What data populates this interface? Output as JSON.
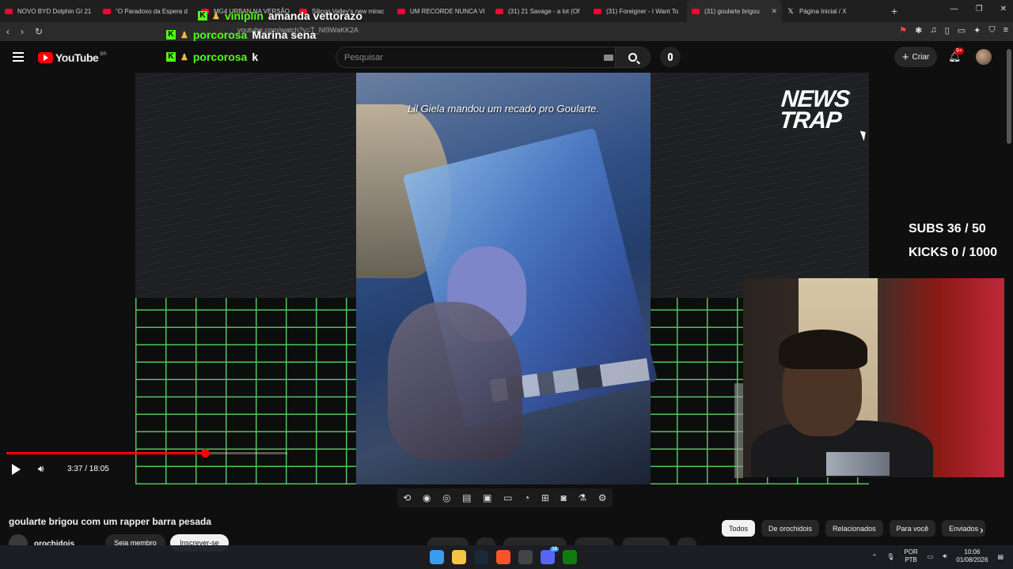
{
  "browser": {
    "tabs": [
      {
        "label": "NOVO BYD Dolphin GI 21",
        "icon": "youtube-icon"
      },
      {
        "label": "\"O Paradoxo da Espera d",
        "icon": "youtube-icon"
      },
      {
        "label": "MG4 URBAN NA VERSÃO",
        "icon": "youtube-icon"
      },
      {
        "label": "Silicon Valley's new mirac",
        "icon": "youtube-icon"
      },
      {
        "label": "UM RECORDE NUNCA VI",
        "icon": "youtube-icon"
      },
      {
        "label": "(31) 21 Savage - a lot (Of",
        "icon": "youtube-icon"
      },
      {
        "label": "(31) Foreigner - I Want To",
        "icon": "youtube-icon"
      },
      {
        "label": "(31) goularte brigou",
        "icon": "youtube-icon",
        "active": true
      },
      {
        "label": "Página Inicial / X",
        "icon": "x-icon"
      }
    ],
    "new_tab": "+",
    "url": "youtube.com/watch?v=T_NI9WaKK2A"
  },
  "youtube": {
    "logo_text": "YouTube",
    "country": "BR",
    "search_placeholder": "Pesquisar",
    "create_label": "Criar",
    "notif_badge": "9+"
  },
  "chat_overlay": [
    {
      "user": "viniplin",
      "message": "amanda vettorazo"
    },
    {
      "user": "porcorosa",
      "message": "Marina sena"
    },
    {
      "user": "porcorosa",
      "message": "k"
    }
  ],
  "video": {
    "caption": "Lil Giela mandou um recado pro Goularte.",
    "brand_line1": "NEWS",
    "brand_line2": "TRAP",
    "subs_goal": "SUBS 36 / 50",
    "kicks_goal": "KICKS 0 / 1000",
    "time": "3:37 / 18:05",
    "progress_fraction": 0.2
  },
  "meta": {
    "title": "goularte brigou com um rapper barra pesada",
    "channel": "orochidois",
    "join_label": "Seja membro",
    "subscribe_label": "Inscrever-se"
  },
  "chips": [
    "Todos",
    "De orochidois",
    "Relacionados",
    "Para você",
    "Enviados"
  ],
  "taskbar": {
    "lang_line1": "POR",
    "lang_line2": "PTB",
    "time": "10:06",
    "date": "01/08/2026",
    "discord_badge": "18"
  }
}
